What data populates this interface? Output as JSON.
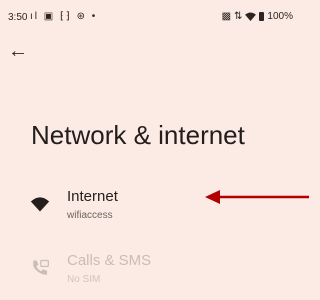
{
  "status_bar": {
    "time": "3:50",
    "icons": [
      "signal-icon",
      "media-icon",
      "vibrate-icon",
      "sync-icon",
      "dot-icon"
    ],
    "battery": "100%"
  },
  "navigation": {
    "back_icon": "back-arrow-icon"
  },
  "page": {
    "title": "Network & internet"
  },
  "items": [
    {
      "title": "Internet",
      "subtitle": "wifiaccess",
      "icon": "wifi-icon",
      "enabled": true
    },
    {
      "title": "Calls & SMS",
      "subtitle": "No SIM",
      "icon": "calls-sms-icon",
      "enabled": false
    }
  ],
  "annotation": {
    "color": "#b00000",
    "target": "Internet"
  },
  "colors": {
    "background": "#fcebe4",
    "text": "#231d1b",
    "disabled": "#c9bdb8"
  }
}
